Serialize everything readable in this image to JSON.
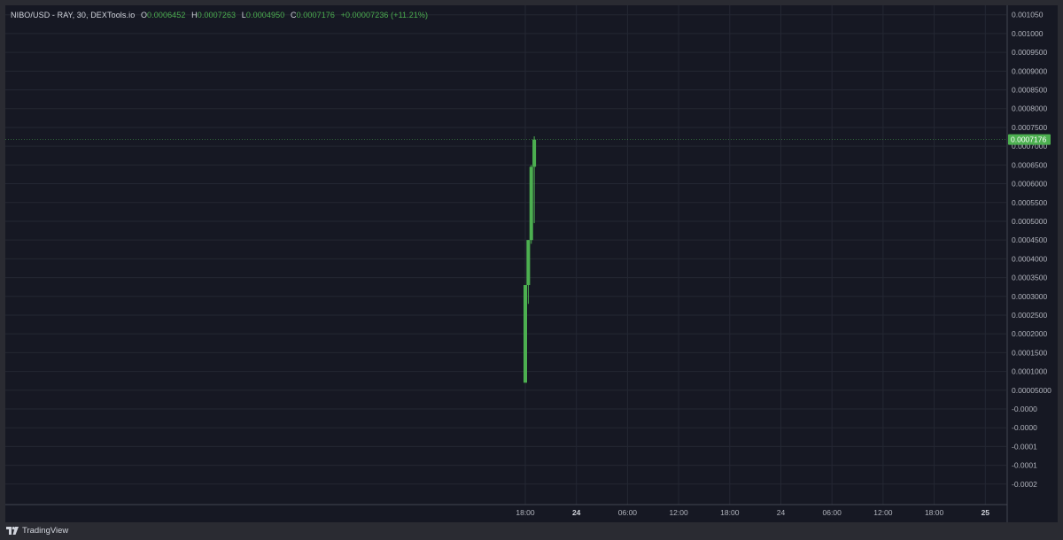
{
  "legend": {
    "symbol": "NIBO/USD - RAY, 30, DEXTools.io",
    "open_key": "O",
    "open": "0.0006452",
    "high_key": "H",
    "high": "0.0007263",
    "low_key": "L",
    "low": "0.0004950",
    "close_key": "C",
    "close": "0.0007176",
    "change": "+0.00007236 (+11.21%)"
  },
  "colors": {
    "background": "#161823",
    "grid": "#242733",
    "up": "#4caf50",
    "axis_text": "#b2b5be",
    "price_tag": "#4caf50"
  },
  "chart_data": {
    "type": "candlestick",
    "title": "NIBO/USD - RAY, 30, DEXTools.io",
    "ylim": [
      -0.00025,
      0.00108
    ],
    "y_ticks": [
      {
        "value": 0.00105,
        "label": "0.001050"
      },
      {
        "value": 0.001,
        "label": "0.001000"
      },
      {
        "value": 0.00095,
        "label": "0.0009500"
      },
      {
        "value": 0.0009,
        "label": "0.0009000"
      },
      {
        "value": 0.00085,
        "label": "0.0008500"
      },
      {
        "value": 0.0008,
        "label": "0.0008000"
      },
      {
        "value": 0.00075,
        "label": "0.0007500"
      },
      {
        "value": 0.0007,
        "label": "0.0007000"
      },
      {
        "value": 0.00065,
        "label": "0.0006500"
      },
      {
        "value": 0.0006,
        "label": "0.0006000"
      },
      {
        "value": 0.00055,
        "label": "0.0005500"
      },
      {
        "value": 0.0005,
        "label": "0.0005000"
      },
      {
        "value": 0.00045,
        "label": "0.0004500"
      },
      {
        "value": 0.0004,
        "label": "0.0004000"
      },
      {
        "value": 0.00035,
        "label": "0.0003500"
      },
      {
        "value": 0.0003,
        "label": "0.0003000"
      },
      {
        "value": 0.00025,
        "label": "0.0002500"
      },
      {
        "value": 0.0002,
        "label": "0.0002000"
      },
      {
        "value": 0.00015,
        "label": "0.0001500"
      },
      {
        "value": 0.0001,
        "label": "0.0001000"
      },
      {
        "value": 5e-05,
        "label": "0.00005000"
      },
      {
        "value": 0.0,
        "label": "-0.0000"
      },
      {
        "value": -5e-05,
        "label": "-0.0000"
      },
      {
        "value": -0.0001,
        "label": "-0.0001"
      },
      {
        "value": -0.00015,
        "label": "-0.0001"
      },
      {
        "value": -0.0002,
        "label": "-0.0002"
      }
    ],
    "x_ticks": [
      {
        "t": 0,
        "label": "18:00",
        "bold": false
      },
      {
        "t": 12,
        "label": "24",
        "bold": true
      },
      {
        "t": 24,
        "label": "06:00",
        "bold": false
      },
      {
        "t": 36,
        "label": "12:00",
        "bold": false
      },
      {
        "t": 48,
        "label": "18:00",
        "bold": false
      },
      {
        "t": 60,
        "label": "24",
        "bold": false
      },
      {
        "t": 72,
        "label": "06:00",
        "bold": false
      },
      {
        "t": 84,
        "label": "12:00",
        "bold": false
      },
      {
        "t": 96,
        "label": "18:00",
        "bold": false
      },
      {
        "t": 108,
        "label": "25",
        "bold": true
      }
    ],
    "last_price": {
      "value": 0.0007176,
      "label": "0.0007176"
    },
    "candles": [
      {
        "t": 0.0,
        "o": 7e-05,
        "h": 0.00033,
        "l": 7e-05,
        "c": 0.00033
      },
      {
        "t": 0.7,
        "o": 0.00033,
        "h": 0.00045,
        "l": 0.00028,
        "c": 0.00045
      },
      {
        "t": 1.4,
        "o": 0.00045,
        "h": 0.00065,
        "l": 0.00044,
        "c": 0.000645
      },
      {
        "t": 2.1,
        "o": 0.0006452,
        "h": 0.0007263,
        "l": 0.000495,
        "c": 0.0007176
      }
    ]
  },
  "footer": {
    "brand": "TradingView"
  }
}
